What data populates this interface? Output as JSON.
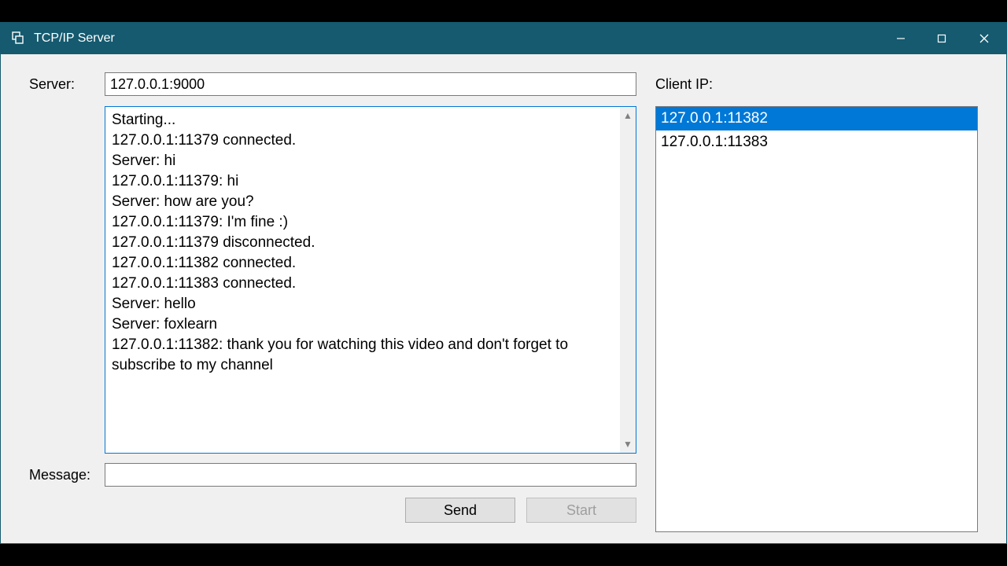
{
  "window": {
    "title": "TCP/IP Server"
  },
  "labels": {
    "server": "Server:",
    "client_ip": "Client IP:",
    "message": "Message:"
  },
  "inputs": {
    "server_value": "127.0.0.1:9000",
    "message_value": ""
  },
  "log": {
    "lines": [
      "Starting...",
      "127.0.0.1:11379 connected.",
      "Server: hi",
      "127.0.0.1:11379: hi",
      "Server: how are you?",
      "127.0.0.1:11379: I'm fine :)",
      "127.0.0.1:11379 disconnected.",
      "127.0.0.1:11382 connected.",
      "127.0.0.1:11383 connected.",
      "Server: hello",
      "Server: foxlearn",
      "127.0.0.1:11382: thank you for watching this video and don't forget to subscribe to my channel"
    ]
  },
  "clients": {
    "items": [
      {
        "ip": "127.0.0.1:11382",
        "selected": true
      },
      {
        "ip": "127.0.0.1:11383",
        "selected": false
      }
    ]
  },
  "buttons": {
    "send": "Send",
    "start": "Start"
  }
}
